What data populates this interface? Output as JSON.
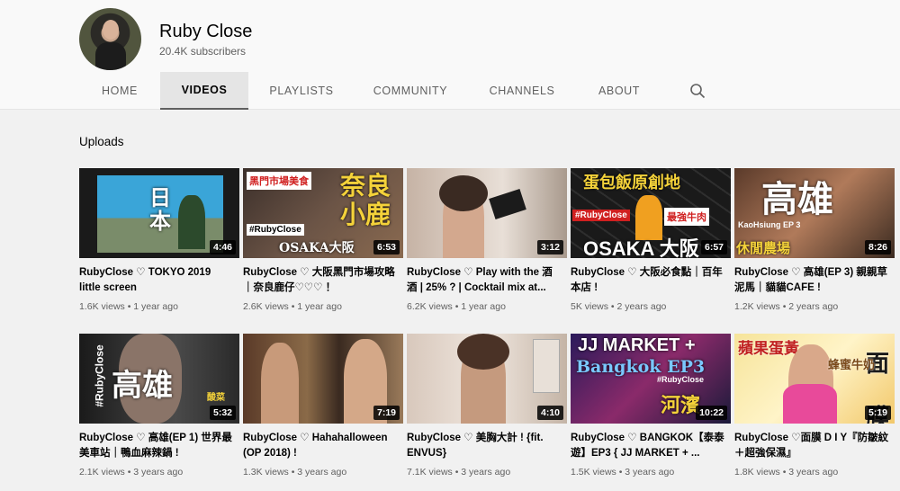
{
  "channel": {
    "name": "Ruby Close",
    "subscribers": "20.4K subscribers"
  },
  "tabs": [
    "HOME",
    "VIDEOS",
    "PLAYLISTS",
    "COMMUNITY",
    "CHANNELS",
    "ABOUT"
  ],
  "active_tab": "VIDEOS",
  "section_title": "Uploads",
  "videos": [
    {
      "title": "RubyClose ♡ TOKYO 2019 little screen",
      "views": "1.6K views",
      "age": "1 year ago",
      "duration": "4:46",
      "thumb_text": "日本"
    },
    {
      "title": "RubyClose ♡ 大阪黑門市場攻略｜奈良鹿仔♡♡♡ ！",
      "views": "2.6K views",
      "age": "1 year ago",
      "duration": "6:53",
      "thumb_text": "奈良小鹿",
      "thumb_sub": "黑門市場美食",
      "thumb_tag": "#RubyClose",
      "thumb_extra": "OSAKA大阪"
    },
    {
      "title": "RubyClose ♡ Play with the 酒酒 | 25% ? | Cocktail mix at...",
      "views": "6.2K views",
      "age": "1 year ago",
      "duration": "3:12"
    },
    {
      "title": "RubyClose ♡ 大阪必食點｜百年本店 !",
      "views": "5K views",
      "age": "2 years ago",
      "duration": "6:57",
      "thumb_text": "OSAKA 大阪",
      "thumb_sub": "蛋包飯原創地",
      "thumb_tag": "#RubyClose",
      "thumb_extra": "最強牛肉"
    },
    {
      "title": "RubyClose ♡ 高雄(EP 3) 親親草泥馬｜貓貓CAFE !",
      "views": "1.2K views",
      "age": "2 years ago",
      "duration": "8:26",
      "thumb_text": "高雄",
      "thumb_sub": "KaoHsiung EP 3",
      "thumb_extra": "休閒農場"
    },
    {
      "title": "RubyClose ♡ 高雄(EP 1) 世界最美車站｜鴨血麻辣鍋 !",
      "views": "2.1K views",
      "age": "3 years ago",
      "duration": "5:32",
      "thumb_text": "高雄",
      "thumb_tag": "#RubyClose",
      "thumb_extra": "酸菜"
    },
    {
      "title": "RubyClose ♡ Hahahalloween (OP 2018) !",
      "views": "1.3K views",
      "age": "3 years ago",
      "duration": "7:19"
    },
    {
      "title": "RubyClose ♡ 美胸大計 ! {fit. ENVUS}",
      "views": "7.1K views",
      "age": "3 years ago",
      "duration": "4:10"
    },
    {
      "title": "RubyClose ♡ BANGKOK【泰泰遊】EP3 { JJ MARKET + ...",
      "views": "1.5K views",
      "age": "3 years ago",
      "duration": "10:22",
      "thumb_text": "JJ MARKET +",
      "thumb_sub": "Bangkok EP3",
      "thumb_tag": "#RubyClose",
      "thumb_extra": "河濱"
    },
    {
      "title": "RubyClose ♡面膜 D I Y『防皺紋＋超強保濕』",
      "views": "1.8K views",
      "age": "3 years ago",
      "duration": "5:19",
      "thumb_text": "面膜",
      "thumb_sub": "蘋果蛋黃",
      "thumb_extra": "蜂蜜牛奶"
    }
  ],
  "colors": {
    "accent_tab_bg": "#e5e5e5",
    "header_bg": "#f9f9f9",
    "page_bg": "#f1f1f1"
  }
}
